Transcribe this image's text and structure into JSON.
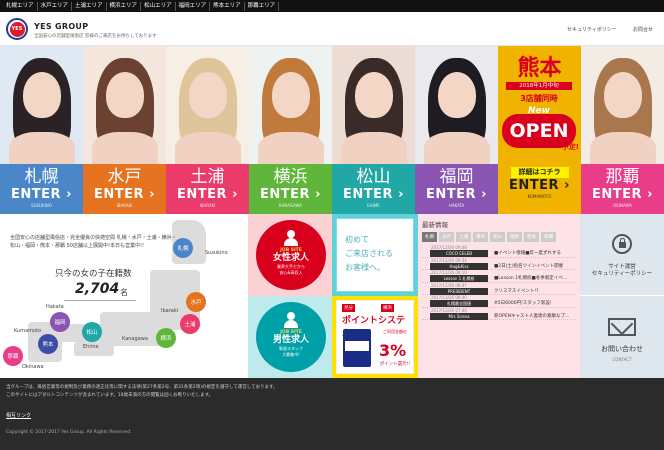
{
  "topnav": [
    "札幌エリア",
    "水戸エリア",
    "土浦エリア",
    "横浜エリア",
    "松山エリア",
    "福岡エリア",
    "熊本エリア",
    "那覇エリア"
  ],
  "header": {
    "logo_text": "YES",
    "brand": "YES GROUP",
    "tagline": "全国安心の店舗型風俗店 皆様のご来店をお待ちしております",
    "link_security": "セキュリティポリシー",
    "link_contact": "お問合せ"
  },
  "areas": [
    {
      "city": "札幌",
      "enter": "ENTER",
      "roman": "SUSUKINO",
      "color": "#4a86c8",
      "hair": "#2b2226"
    },
    {
      "city": "水戸",
      "enter": "ENTER",
      "roman": "IBARAKI",
      "color": "#e5731f",
      "hair": "#6b4232"
    },
    {
      "city": "土浦",
      "enter": "ENTER",
      "roman": "IBARAKI",
      "color": "#ea3b6a",
      "hair": "#e0c49a"
    },
    {
      "city": "横浜",
      "enter": "ENTER",
      "roman": "KANAGAWA",
      "color": "#5fb63a",
      "hair": "#c07a3c"
    },
    {
      "city": "松山",
      "enter": "ENTER",
      "roman": "EHIME",
      "color": "#21a7a6",
      "hair": "#3b2b28"
    },
    {
      "city": "福岡",
      "enter": "ENTER",
      "roman": "HAKATA",
      "color": "#8a54b3",
      "hair": "#1f1b22"
    },
    {
      "city": "",
      "enter": "ENTER",
      "roman": "KUMAMOTO",
      "color": "#f0b400",
      "hair": ""
    },
    {
      "city": "那覇",
      "enter": "ENTER",
      "roman": "OKINAWA",
      "color": "#e93d8a",
      "hair": "#a9774d"
    }
  ],
  "kumamoto": {
    "big": "熊本",
    "date": "2018年1月中旬",
    "line": "3店舗同時",
    "new": "New",
    "open": "OPEN",
    "yotei": "予定!",
    "detail": "詳細はコチラ"
  },
  "map": {
    "intro": "全国安心の店舗型風俗店・完全優良の快適空間 札幌・水戸・土浦・横浜・松山・福岡・熊本・那覇 50店舗以上展開中!本日も営業中!!",
    "count_label": "只今の女の子在籍数",
    "count": "2,704",
    "count_unit": "名",
    "dots": [
      {
        "name": "札幌",
        "color": "#4a86c8",
        "label": "Susukino"
      },
      {
        "name": "水戸",
        "color": "#e5731f",
        "label": ""
      },
      {
        "name": "土浦",
        "color": "#ea3b6a",
        "label": "Ibaraki"
      },
      {
        "name": "横浜",
        "color": "#5fb63a",
        "label": "Kanagawa"
      },
      {
        "name": "松山",
        "color": "#21a7a6",
        "label": "Ehime"
      },
      {
        "name": "福岡",
        "color": "#8a54b3",
        "label": "Hakata"
      },
      {
        "name": "熊本",
        "color": "#3b4ea6",
        "label": "Kumamoto"
      },
      {
        "name": "那覇",
        "color": "#e93d8a",
        "label": "Okinawa"
      }
    ]
  },
  "recruit_female": {
    "site": "JOB SITE",
    "title": "女性求人",
    "sub1": "業界大手だから",
    "sub2": "安心&高収入"
  },
  "recruit_male": {
    "site": "JOB SITE",
    "title": "男性求人",
    "sub1": "幹部スタッフ",
    "sub2": "大募集中!"
  },
  "visitors": {
    "line1": "初めて",
    "line2": "ご来店される",
    "line3": "お客様へ。"
  },
  "points": {
    "tag1": "見分",
    "tag2": "横浜",
    "title": "ポイントシステム",
    "note": "ご利用金額の",
    "pct": "3%",
    "sub": "ポイント還元!!"
  },
  "news": {
    "title": "最新情報",
    "tabs": [
      "札幌",
      "水戸",
      "土浦",
      "横浜",
      "松山",
      "福岡",
      "熊本",
      "那覇"
    ],
    "items": [
      {
        "date": "2017/12/26 09:48",
        "shop": "COCO CELEB",
        "text": "■イベント情報■年一度ずれする"
      },
      {
        "date": "2017/12/26 09:34",
        "shop": "Hug&Kiss",
        "text": "■2日(土)指名ツインイベント開催"
      },
      {
        "date": "2017/12/26 09:10",
        "shop": "Lesson 1 札幌校",
        "text": "■Lesson 1札幌校■冬季限定イベ…"
      },
      {
        "date": "2017/12/26 08:47",
        "shop": "PRESIDENT",
        "text": "クリスマスイベント!?"
      },
      {
        "date": "2017/12/26 08:40",
        "shop": "札幌最全国値",
        "text": "#5日6000円!スタッフ新設!"
      },
      {
        "date": "2017/12/26 07:40",
        "shop": "Mrs Sirena",
        "text": "新OPENキャスト人妻達の素敵なプ…"
      }
    ]
  },
  "security": {
    "line1": "サイト運営",
    "line2": "セキュリティーポリシー"
  },
  "contact": {
    "title": "お問い合わせ",
    "sub": "CONTACT"
  },
  "footer": {
    "note1": "当グループは、風俗営業等の規制及び業務の適正化等に関する法律(第27条第2号、第31条第2項)の規定を遵守して運営しております。",
    "note2": "このサイトにはアダルトコンテンツが含まれています。18歳未満の方の閲覧は固くお断りいたします。",
    "link": "相互リンク",
    "copyright": "Copyright © 2017-2017 Yes Group. All Rights Reserved."
  }
}
